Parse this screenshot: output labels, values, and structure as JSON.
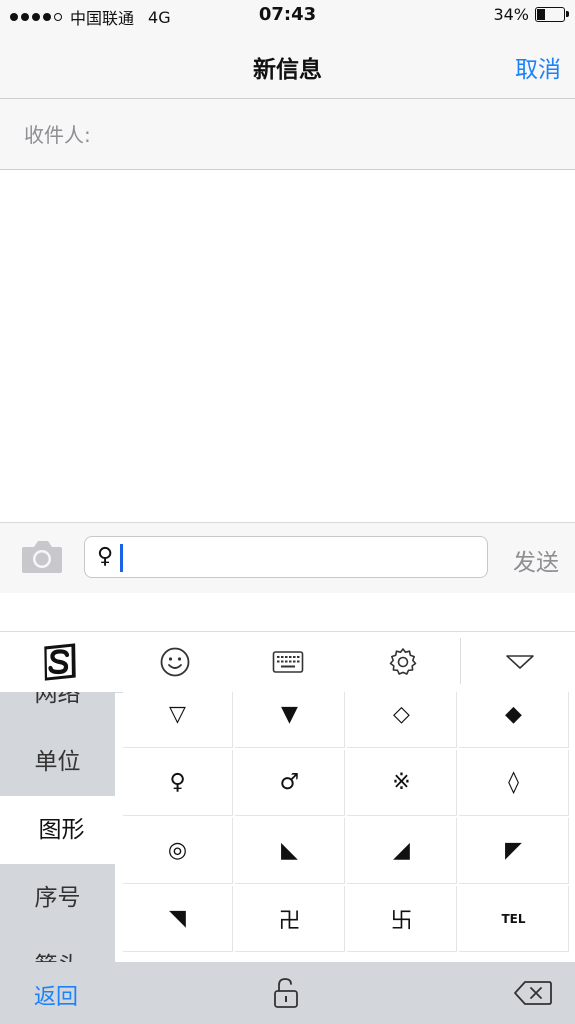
{
  "status_bar": {
    "carrier": "中国联通",
    "network": "4G",
    "time": "07:43",
    "battery_percent": "34%",
    "battery_level": 0.34,
    "signal_bars": 4,
    "signal_total": 5
  },
  "nav": {
    "title": "新信息",
    "cancel_label": "取消"
  },
  "recipient": {
    "label": "收件人:"
  },
  "compose": {
    "input_value": "♀",
    "send_label": "发送"
  },
  "keyboard": {
    "toolbar_icons": [
      "sogou-logo-icon",
      "smiley-icon",
      "keyboard-icon",
      "gear-icon",
      "hide-keyboard-icon"
    ],
    "categories": [
      {
        "label": "网络",
        "active": false
      },
      {
        "label": "单位",
        "active": false
      },
      {
        "label": "图形",
        "active": true
      },
      {
        "label": "序号",
        "active": false
      },
      {
        "label": "箭头",
        "active": false
      }
    ],
    "symbols": [
      [
        "▽",
        "▼",
        "◇",
        "◆"
      ],
      [
        "♀",
        "♂",
        "※",
        "◊"
      ],
      [
        "◎",
        "◣",
        "◢",
        "◤"
      ],
      [
        "◥",
        "卍",
        "卐",
        "TEL"
      ]
    ],
    "back_label": "返回"
  },
  "colors": {
    "accent": "#1a82fb",
    "bar_background": "#f7f7f7",
    "keyboard_gray": "#d3d6db",
    "caret": "#1a63e8"
  }
}
